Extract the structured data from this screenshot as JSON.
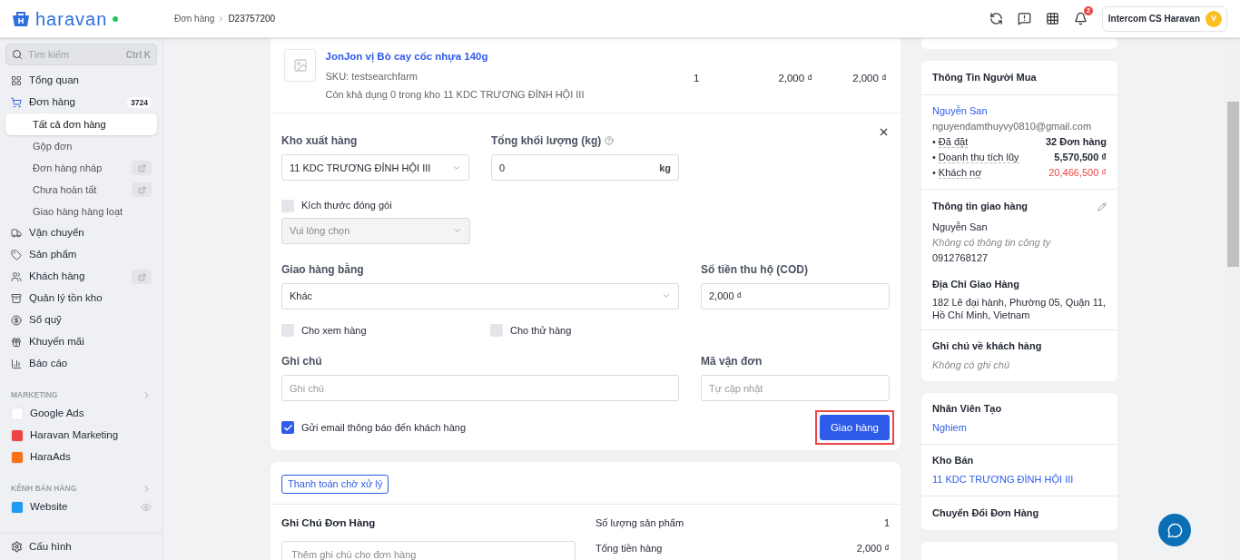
{
  "header": {
    "logo": "haravan",
    "online": true,
    "breadcrumb": [
      "Đơn hàng",
      "D23757200"
    ],
    "notification_count": "2",
    "account": {
      "name": "Intercom CS Haravan",
      "initial": "V"
    }
  },
  "sidebar": {
    "search": {
      "placeholder": "Tìm kiếm",
      "shortcut": "Ctrl K"
    },
    "items": [
      {
        "label": "Tổng quan",
        "selected": false
      },
      {
        "label": "Đơn hàng",
        "selected": false,
        "badge": "3724",
        "children": [
          {
            "label": "Tất cả đơn hàng",
            "selected": true,
            "link_icon": false
          },
          {
            "label": "Gộp đơn",
            "selected": false,
            "link_icon": false
          },
          {
            "label": "Đơn hàng nháp",
            "selected": false,
            "link_icon": true
          },
          {
            "label": "Chưa hoàn tất",
            "selected": false,
            "link_icon": true
          },
          {
            "label": "Giao hàng hàng loạt",
            "selected": false,
            "link_icon": false
          }
        ]
      },
      {
        "label": "Vận chuyển",
        "selected": false
      },
      {
        "label": "Sản phẩm",
        "selected": false
      },
      {
        "label": "Khách hàng",
        "selected": false,
        "link_icon": true
      },
      {
        "label": "Quản lý tồn kho",
        "selected": false
      },
      {
        "label": "Sổ quỹ",
        "selected": false
      },
      {
        "label": "Khuyến mãi",
        "selected": false
      },
      {
        "label": "Báo cáo",
        "selected": false
      }
    ],
    "sections": [
      {
        "title": "MARKETING",
        "items": [
          {
            "label": "Google Ads",
            "color": "#ffffff"
          },
          {
            "label": "Haravan Marketing",
            "color": "#ef4444"
          },
          {
            "label": "HaraAds",
            "color": "#f97316"
          }
        ]
      },
      {
        "title": "KÊNH BÁN HÀNG",
        "items": [
          {
            "label": "Website",
            "color": "#1d9bf0",
            "eye": true
          }
        ]
      }
    ],
    "footer": "Cấu hình"
  },
  "product": {
    "name": "JonJon vị Bò cay cốc nhựa 140g",
    "sku": "SKU: testsearchfarm",
    "stock": "Còn khả dụng 0 trong kho 11 KDC TRƯƠNG ĐỈNH HỘI III",
    "quantity": "1",
    "price": "2,000 ₫",
    "total": "2,000 ₫"
  },
  "fulfillment": {
    "warehouse": {
      "label": "Kho xuất hàng",
      "value": "11 KDC TRƯƠNG ĐỈNH HỘI III"
    },
    "weight": {
      "label": "Tổng khối lượng (kg)",
      "value": "0",
      "unit": "kg"
    },
    "package": {
      "label": "Kích thước đóng gói",
      "checked": false,
      "placeholder": "Vui lòng chọn",
      "disabled": true
    },
    "carrier": {
      "label": "Giao hàng bằng",
      "value": "Khác"
    },
    "cod": {
      "label": "Số tiền thu hộ (COD)",
      "value": "2,000 ₫"
    },
    "options": [
      {
        "label": "Cho xem hàng",
        "checked": false
      },
      {
        "label": "Cho thử hàng",
        "checked": false
      }
    ],
    "note": {
      "label": "Ghi chú",
      "placeholder": "Ghi chú"
    },
    "tracking": {
      "label": "Mã vận đơn",
      "placeholder": "Tự cập nhật"
    },
    "email": {
      "label": "Gửi email thông báo đến khách hàng",
      "checked": true
    },
    "submit": {
      "label": "Giao hàng",
      "highlighted": true
    }
  },
  "payment": {
    "status": "Thanh toán chờ xử lý",
    "note_title": "Ghi Chú Đơn Hàng",
    "note_placeholder": "Thêm ghi chú cho đơn hàng",
    "summary": [
      {
        "label": "Số lượng sản phẩm",
        "value": "1"
      },
      {
        "label": "Tổng tiền hàng",
        "value": "2,000 ₫"
      }
    ]
  },
  "buyer": {
    "title": "Thông Tin Người Mua",
    "name": "Nguyễn San",
    "email": "nguyendamthuyvy0810@gmail.com",
    "stats": [
      {
        "bullet": "•",
        "label": "Đã đặt",
        "value": "32 Đơn hàng",
        "negative": false
      },
      {
        "bullet": "•",
        "label": "Doanh thu tích lũy",
        "value": "5,570,500 ₫",
        "negative": false
      },
      {
        "bullet": "•",
        "label": "Khách nợ",
        "value": "20,466,500 ₫",
        "negative": true
      }
    ],
    "shipping_title": "Thông tin giao hàng",
    "shipping_name": "Nguyễn San",
    "company": "Không có thông tin công ty",
    "phone": "0912768127",
    "address_title": "Địa Chỉ Giao Hàng",
    "address": "182 Lê đại hành, Phường 05, Quận 11, Hồ Chí Minh, Vietnam",
    "notes_title": "Ghi chú về khách hàng",
    "notes": "Không có ghi chú"
  },
  "staff": {
    "creator_title": "Nhân Viên Tạo",
    "creator": "Nghiem",
    "store_title": "Kho Bán",
    "store": "11 KDC TRƯƠNG ĐÌNH HỘI III",
    "convert_title": "Chuyển Đổi Đơn Hàng"
  }
}
